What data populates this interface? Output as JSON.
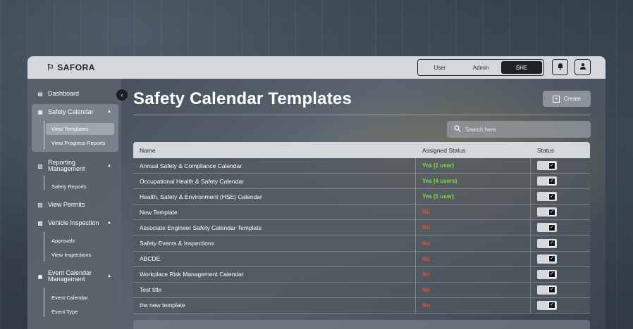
{
  "app": {
    "brand": "SAFORA"
  },
  "roles": [
    {
      "label": "User",
      "active": false
    },
    {
      "label": "Admin",
      "active": false
    },
    {
      "label": "SHE",
      "active": true
    }
  ],
  "header_icons": [
    "bell-icon",
    "user-icon"
  ],
  "sidebar": {
    "items": [
      {
        "label": "Dashboard",
        "icon": "dashboard-icon"
      },
      {
        "label": "Safety Calendar",
        "icon": "calendar-icon",
        "expanded": true,
        "children": [
          "View Templates",
          "View Progress Reports"
        ]
      },
      {
        "label": "Reporting Management",
        "icon": "report-icon",
        "expanded": true,
        "children": [
          "Safety Reports"
        ]
      },
      {
        "label": "View Permits",
        "icon": "permit-icon"
      },
      {
        "label": "Vehicle Inspection",
        "icon": "inspection-icon",
        "expanded": true,
        "children": [
          "Approvals",
          "View Inspections"
        ]
      },
      {
        "label": "Event Calendar Management",
        "icon": "event-icon",
        "expanded": true,
        "children": [
          "Event Calendar",
          "Event Type"
        ]
      }
    ],
    "active_child": "View Templates"
  },
  "page": {
    "title": "Safety Calendar Templates",
    "create_label": "Create",
    "search_placeholder": "Search here"
  },
  "table": {
    "columns": [
      "Name",
      "Assigned Status",
      "Status"
    ],
    "rows": [
      {
        "name": "Annual Safety & Compliance Calendar",
        "assigned": "Yes (1 user)",
        "assigned_yes": true,
        "status": true
      },
      {
        "name": "Occupational Health & Safety Calendar",
        "assigned": "Yes (4 users)",
        "assigned_yes": true,
        "status": true
      },
      {
        "name": "Health, Safety & Environment (HSE) Calendar",
        "assigned": "Yes (1 user)",
        "assigned_yes": true,
        "status": true
      },
      {
        "name": "New Template",
        "assigned": "No",
        "assigned_yes": false,
        "status": true
      },
      {
        "name": "Associate Engineer Safety Calendar Template",
        "assigned": "No",
        "assigned_yes": false,
        "status": true
      },
      {
        "name": "Safety Events & Inspections",
        "assigned": "No",
        "assigned_yes": false,
        "status": true
      },
      {
        "name": "ABCDE",
        "assigned": "No",
        "assigned_yes": false,
        "status": true
      },
      {
        "name": "Workplace Risk Management Calendar",
        "assigned": "No",
        "assigned_yes": false,
        "status": true
      },
      {
        "name": "Test title",
        "assigned": "No",
        "assigned_yes": false,
        "status": true
      },
      {
        "name": "the new template",
        "assigned": "No",
        "assigned_yes": false,
        "status": true
      }
    ]
  },
  "colors": {
    "yes": "#7ee03a",
    "no": "#e8512a",
    "topbar": "#d4d8dc",
    "dark": "#1f2226"
  }
}
